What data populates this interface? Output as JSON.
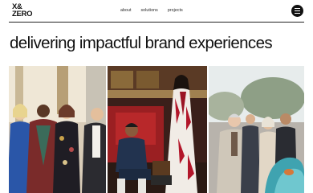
{
  "brand": {
    "logo_line1": "X&",
    "logo_line2": "ZERO"
  },
  "nav": {
    "about": "about",
    "solutions": "solutions",
    "projects": "projects"
  },
  "hero": {
    "headline": "delivering impactful brand experiences"
  },
  "colors": {
    "text": "#111111",
    "background": "#ffffff",
    "menu_button": "#111111"
  },
  "icons": {
    "menu": "hamburger-menu-icon"
  }
}
